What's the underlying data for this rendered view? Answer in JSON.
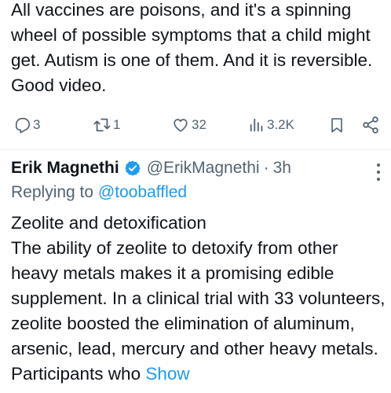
{
  "tweet1": {
    "text": "All vaccines are poisons, and it's a spinning wheel of possible symptoms that a child might get. Autism is one of them. And it is reversible. Good video.",
    "replies": "3",
    "retweets": "1",
    "likes": "32",
    "views": "3.2K"
  },
  "tweet2": {
    "author_name": "Erik Magnethi",
    "handle": "@ErikMagnethi",
    "separator": "·",
    "time": "3h",
    "replying_prefix": "Replying to",
    "replying_handle": "@toobaffled",
    "text": "Zeolite and detoxification\nThe ability of zeolite to detoxify from other heavy metals makes it a promising edible supplement. In a clinical trial with 33 volunteers, zeolite boosted the elimination of aluminum, arsenic, lead, mercury and other heavy metals. Participants who",
    "show_more": "Show"
  },
  "colors": {
    "link": "#1d9bf0",
    "secondary": "#536471",
    "text": "#0f1419",
    "verified": "#1d9bf0"
  },
  "icons": [
    "reply-icon",
    "retweet-icon",
    "like-icon",
    "views-icon",
    "bookmark-icon",
    "share-icon",
    "verified-badge-icon",
    "more-options-icon"
  ]
}
